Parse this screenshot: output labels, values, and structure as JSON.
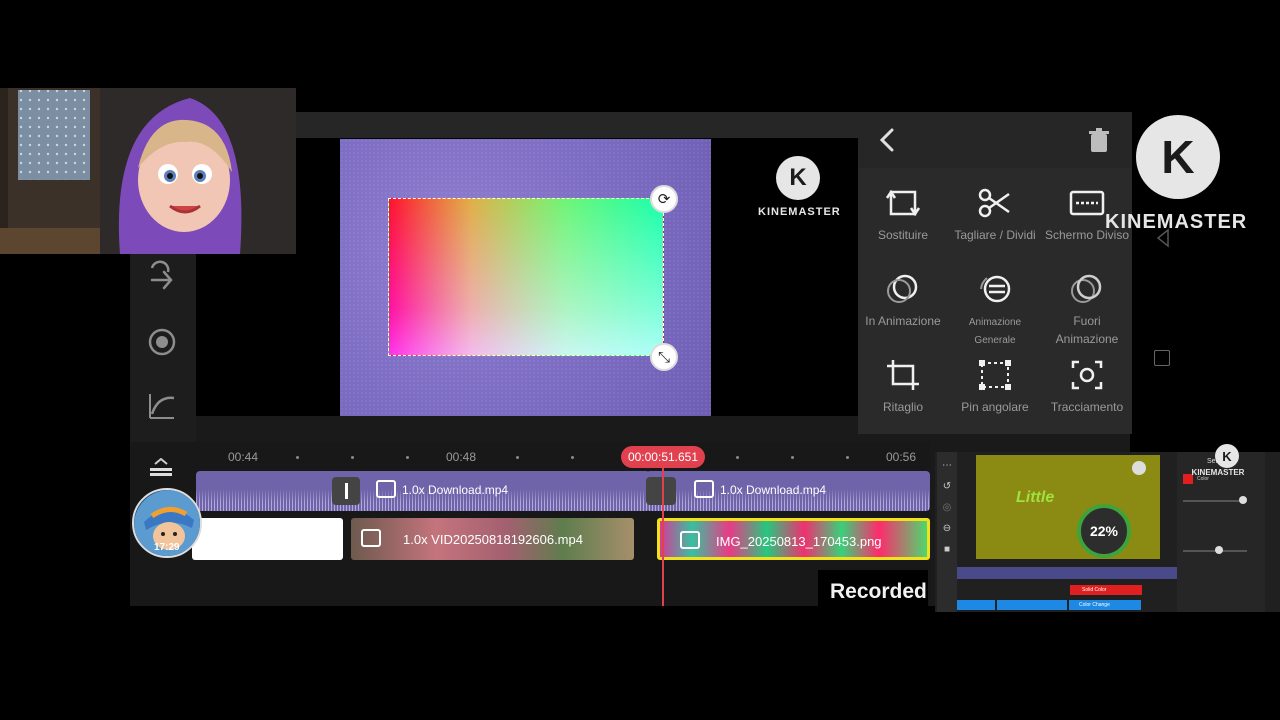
{
  "toolbar": {
    "back_icon": "chevron-left-icon",
    "delete_icon": "trash-icon"
  },
  "menu": {
    "items": [
      {
        "label": "Sostituire",
        "icon": "replace-icon"
      },
      {
        "label": "Tagliare / Dividi",
        "icon": "scissors-icon"
      },
      {
        "label": "Schermo Diviso",
        "icon": "split-screen-icon"
      },
      {
        "label": "In Animazione",
        "icon": "in-animation-icon"
      },
      {
        "label": "Animazione Generale",
        "icon": "overall-animation-icon"
      },
      {
        "label": "Fuori Animazione",
        "icon": "out-animation-icon"
      },
      {
        "label": "Ritaglio",
        "icon": "crop-icon"
      },
      {
        "label": "Pin angolare",
        "icon": "corner-pin-icon"
      },
      {
        "label": "Tracciamento",
        "icon": "tracking-icon"
      }
    ]
  },
  "branding": {
    "logo_letter": "K",
    "name": "KINEMASTER"
  },
  "timeline": {
    "ticks": [
      "00:44",
      "00:48",
      "00:56"
    ],
    "playhead": "00:00:51.651",
    "clips": {
      "audio1": "1.0x Download.mp4",
      "audio2": "1.0x Download.mp4",
      "video1": "1.0x VID20250818192606.mp4",
      "image1": "IMG_20250813_170453.png"
    },
    "avatar_time": "17:29"
  },
  "overlay_text": {
    "recorded": "Recorded"
  },
  "mini_screen": {
    "settings_title": "Settings",
    "color_label": "Color",
    "progress": "22%",
    "progress_value": 0.22,
    "brand": "KINEMASTER",
    "sticker_text": "Little",
    "solid_color": "Solid Color",
    "color_change": "Color Change"
  },
  "colors": {
    "accent_red": "#e1404f",
    "selection_yellow": "#f2e21a",
    "audio_purple": "#6f63aa"
  }
}
